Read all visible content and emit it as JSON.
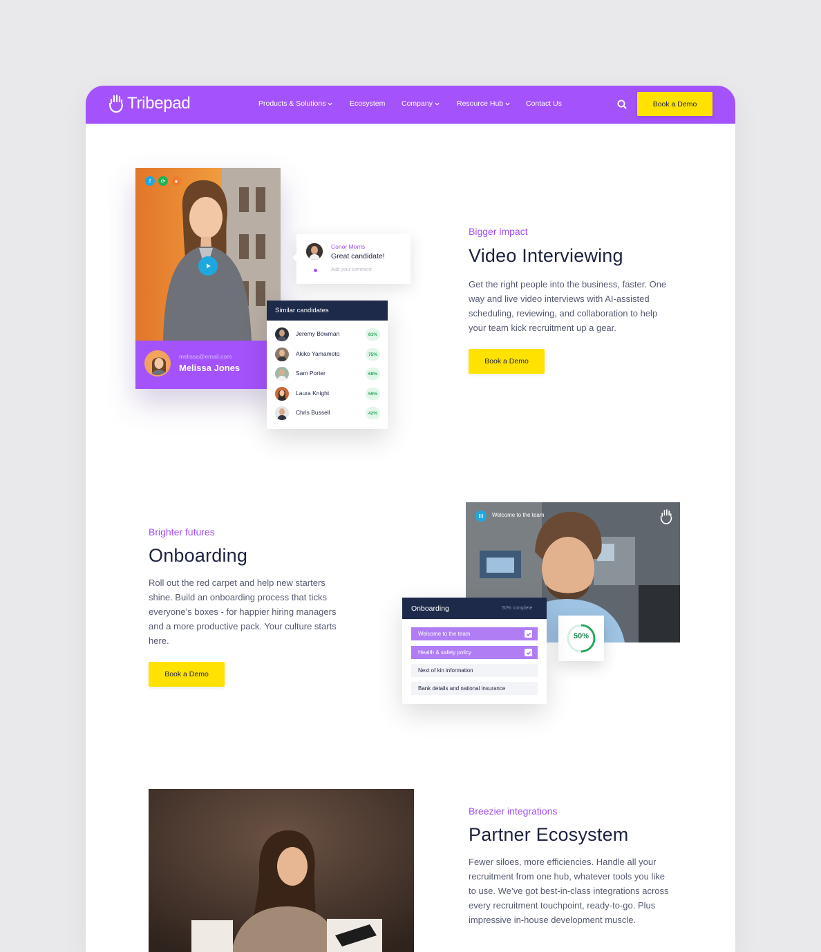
{
  "nav": {
    "logo_text": "Tribepad",
    "items": [
      {
        "label": "Products & Solutions",
        "has_dropdown": true
      },
      {
        "label": "Ecosystem",
        "has_dropdown": false
      },
      {
        "label": "Company",
        "has_dropdown": true
      },
      {
        "label": "Resource Hub",
        "has_dropdown": true
      },
      {
        "label": "Contact Us",
        "has_dropdown": false
      }
    ],
    "search_icon": "search-icon",
    "cta_label": "Book a Demo"
  },
  "colors": {
    "brand_purple": "#a452fb",
    "cta_yellow": "#ffe200",
    "navy": "#1d2a4a",
    "success_green": "#28a85e"
  },
  "video_section": {
    "eyebrow": "Bigger impact",
    "title": "Video Interviewing",
    "body": "Get the right people into the business, faster. One way and live video interviews with AI-assisted scheduling, reviewing, and collaboration to help your team kick recruitment up a gear.",
    "cta_label": "Book a Demo",
    "candidate": {
      "email": "melissa@email.com",
      "name": "Melissa Jones"
    },
    "comment": {
      "author": "Conor Morris",
      "text": "Great candidate!",
      "placeholder": "Add your comment"
    },
    "similar": {
      "title": "Similar candidates",
      "rows": [
        {
          "name": "Jeremy Bowman",
          "pct": "81%"
        },
        {
          "name": "Akiko Yamamoto",
          "pct": "75%"
        },
        {
          "name": "Sam Porter",
          "pct": "68%"
        },
        {
          "name": "Laura Knight",
          "pct": "59%"
        },
        {
          "name": "Chris Bussell",
          "pct": "42%"
        }
      ]
    }
  },
  "onboarding_section": {
    "eyebrow": "Brighter futures",
    "title": "Onboarding",
    "body": "Roll out the red carpet and help new starters shine. Build an onboarding process that ticks everyone’s boxes - for happier hiring managers and a more productive pack. Your culture starts here.",
    "cta_label": "Book a Demo",
    "video_label": "Welcome to the team",
    "card_title": "Onboarding",
    "card_status": "50% complete",
    "progress_label": "50%",
    "progress_value": 0.5,
    "tasks": [
      {
        "label": "Welcome to the team",
        "done": true
      },
      {
        "label": "Health & safety policy",
        "done": true
      },
      {
        "label": "Next of kin information",
        "done": false
      },
      {
        "label": "Bank details and national insurance",
        "done": false
      }
    ]
  },
  "partner_section": {
    "eyebrow": "Breezier integrations",
    "title": "Partner Ecosystem",
    "body": "Fewer siloes, more efficiencies. Handle all your recruitment from one hub, whatever tools you like to use. We’ve got best-in-class integrations across every recruitment touchpoint, ready-to-go. Plus impressive in-house development muscle."
  }
}
